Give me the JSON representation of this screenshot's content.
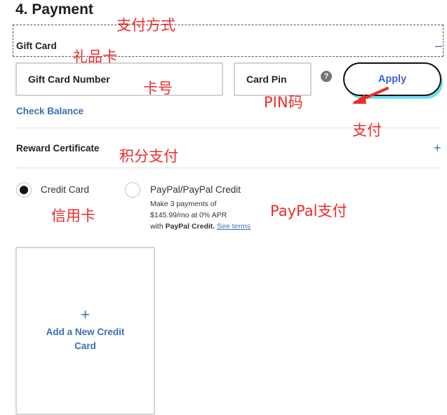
{
  "section": {
    "title": "4. Payment"
  },
  "gift_card": {
    "label": "Gift Card",
    "collapse_icon": "minus-icon",
    "number_placeholder": "Gift Card Number",
    "pin_placeholder": "Card Pin",
    "help_icon": "question-mark-icon",
    "help_glyph": "?",
    "apply_label": "Apply",
    "check_balance": "Check Balance"
  },
  "reward": {
    "label": "Reward Certificate",
    "expand_icon": "plus-icon",
    "expand_glyph": "+"
  },
  "payment_methods": {
    "credit_card": {
      "label": "Credit Card",
      "selected": true
    },
    "paypal": {
      "label": "PayPal/PayPal Credit",
      "selected": false,
      "desc_line1": "Make 3 payments of",
      "desc_line2": "$145.99/mo at 0% APR",
      "desc_with": "with",
      "desc_brand": "PayPal Credit.",
      "see_terms": "See terms"
    }
  },
  "add_card": {
    "plus_glyph": "+",
    "label": "Add a New Credit Card"
  },
  "annotations": {
    "payment_method": "支付方式",
    "gift_card": "礼品卡",
    "card_number": "卡号",
    "pin": "PIN码",
    "pay": "支付",
    "points_pay": "积分支付",
    "credit_card": "信用卡",
    "paypal_pay": "PayPal支付"
  },
  "colors": {
    "accent": "#3a6fb5",
    "annotation": "#ee2a2a",
    "apply_text": "#3f62d6",
    "apply_shadow": "#6ee0ee"
  }
}
